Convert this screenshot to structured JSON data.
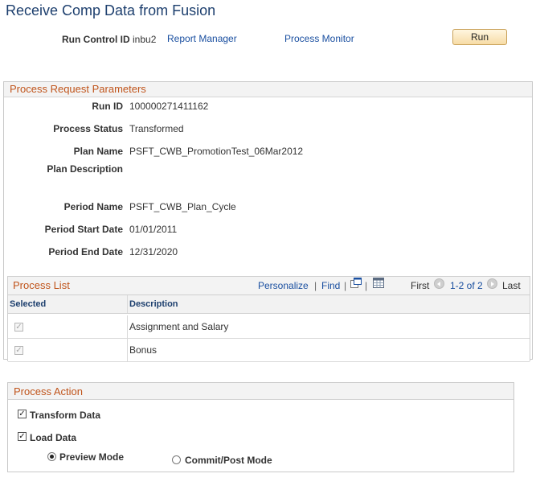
{
  "page": {
    "title": "Receive Comp Data from Fusion"
  },
  "run_control": {
    "label": "Run Control ID",
    "value": "inbu2",
    "report_manager": "Report Manager",
    "process_monitor": "Process Monitor",
    "run_button": "Run"
  },
  "parameters": {
    "title": "Process Request Parameters",
    "fields": [
      {
        "label": "Run ID",
        "value": "100000271411162"
      },
      {
        "label": "Process Status",
        "value": "Transformed"
      },
      {
        "label": "Plan Name",
        "value": "PSFT_CWB_PromotionTest_06Mar2012"
      },
      {
        "label": "Plan Description",
        "value": ""
      },
      {
        "label": "Period Name",
        "value": "PSFT_CWB_Plan_Cycle"
      },
      {
        "label": "Period Start Date",
        "value": "01/01/2011"
      },
      {
        "label": "Period End Date",
        "value": "12/31/2020"
      }
    ]
  },
  "process_list": {
    "title": "Process List",
    "personalize": "Personalize",
    "separator": "|",
    "find": "Find",
    "first": "First",
    "range": "1-2 of 2",
    "last": "Last",
    "columns": {
      "selected": "Selected",
      "description": "Description"
    },
    "rows": [
      {
        "selected": true,
        "description": "Assignment and Salary"
      },
      {
        "selected": true,
        "description": "Bonus"
      }
    ]
  },
  "process_action": {
    "title": "Process Action",
    "transform_label": "Transform Data",
    "transform_checked": true,
    "load_label": "Load Data",
    "load_checked": true,
    "preview_label": "Preview Mode",
    "commit_label": "Commit/Post Mode",
    "selected_mode": "Preview Mode"
  },
  "icons": {
    "view_all": "new-window-icon",
    "download": "spreadsheet-download-icon",
    "prev": "previous-row-arrow-icon",
    "next": "next-row-arrow-icon",
    "check": "✓"
  },
  "colors": {
    "title": "#1d3f6e",
    "link": "#1a4fa0",
    "group_title": "#c0541b",
    "run_button": "#f7dca6"
  }
}
